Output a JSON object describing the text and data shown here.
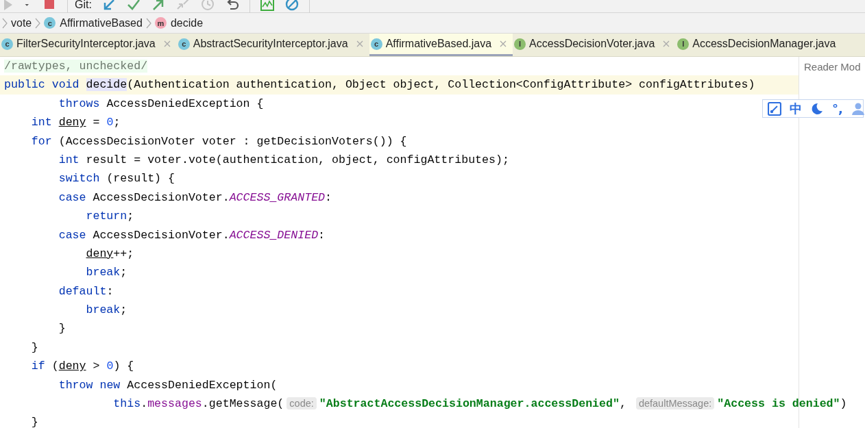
{
  "toolbar": {
    "items": [
      {
        "kind": "run",
        "disabled": true
      },
      {
        "kind": "dropdown",
        "disabled": false
      },
      {
        "kind": "stop",
        "disabled": false
      },
      {
        "kind": "separator"
      },
      {
        "kind": "label",
        "text": "Git:"
      },
      {
        "kind": "update",
        "disabled": false
      },
      {
        "kind": "commit",
        "disabled": false
      },
      {
        "kind": "push",
        "disabled": false
      },
      {
        "kind": "merge",
        "disabled": true
      },
      {
        "kind": "history",
        "disabled": true
      },
      {
        "kind": "rollback",
        "disabled": false
      },
      {
        "kind": "separator"
      },
      {
        "kind": "chart",
        "disabled": false
      },
      {
        "kind": "block",
        "disabled": false
      },
      {
        "kind": "separator"
      }
    ]
  },
  "breadcrumbs": [
    {
      "label": "vote"
    },
    {
      "kind": "class",
      "letter": "c",
      "label": "AffirmativeBased"
    },
    {
      "kind": "method",
      "letter": "m",
      "label": "decide"
    }
  ],
  "tabs": [
    {
      "kind": "class",
      "letter": "c",
      "label": "FilterSecurityInterceptor.java",
      "selected": false,
      "closable": true
    },
    {
      "kind": "class",
      "letter": "c",
      "label": "AbstractSecurityInterceptor.java",
      "selected": false,
      "closable": true
    },
    {
      "kind": "class",
      "letter": "c",
      "label": "AffirmativeBased.java",
      "selected": true,
      "closable": true
    },
    {
      "kind": "interface",
      "letter": "I",
      "label": "AccessDecisionVoter.java",
      "selected": false,
      "closable": true
    },
    {
      "kind": "interface",
      "letter": "I",
      "label": "AccessDecisionManager.java",
      "selected": false,
      "closable": false
    }
  ],
  "reader_mode": "Reader Mod",
  "ime_toolbar": {
    "items": [
      {
        "kind": "gauge"
      },
      {
        "kind": "text",
        "text": "中"
      },
      {
        "kind": "moon"
      },
      {
        "kind": "text",
        "text": "°,"
      },
      {
        "kind": "person"
      }
    ]
  },
  "code": {
    "lines": [
      {
        "current": false,
        "tokens": [
          {
            "kind": "annotation",
            "text": "/rawtypes, unchecked/"
          }
        ]
      },
      {
        "current": true,
        "tokens": [
          {
            "kind": "keyword",
            "text": "public void "
          },
          {
            "kind": "highlight",
            "text": "decide"
          },
          {
            "kind": "plain",
            "text": "(Authentication authentication, Object object, Collection<ConfigAttribute> configAttributes)"
          }
        ]
      },
      {
        "current": false,
        "tokens": [
          {
            "kind": "keyword",
            "text": "        throws"
          },
          {
            "kind": "plain",
            "text": " AccessDeniedException {"
          }
        ]
      },
      {
        "current": false,
        "tokens": [
          {
            "kind": "keyword",
            "text": "    int "
          },
          {
            "kind": "local",
            "text": "deny"
          },
          {
            "kind": "plain",
            "text": " = "
          },
          {
            "kind": "number",
            "text": "0"
          },
          {
            "kind": "plain",
            "text": ";"
          }
        ]
      },
      {
        "current": false,
        "tokens": [
          {
            "kind": "keyword",
            "text": "    for"
          },
          {
            "kind": "plain",
            "text": " (AccessDecisionVoter voter : getDecisionVoters()) {"
          }
        ]
      },
      {
        "current": false,
        "tokens": [
          {
            "kind": "keyword",
            "text": "        int"
          },
          {
            "kind": "plain",
            "text": " result = voter.vote(authentication, object, configAttributes);"
          }
        ]
      },
      {
        "current": false,
        "tokens": [
          {
            "kind": "keyword",
            "text": "        switch"
          },
          {
            "kind": "plain",
            "text": " (result) {"
          }
        ]
      },
      {
        "current": false,
        "tokens": [
          {
            "kind": "keyword",
            "text": "        case"
          },
          {
            "kind": "plain",
            "text": " AccessDecisionVoter."
          },
          {
            "kind": "constant",
            "text": "ACCESS_GRANTED"
          },
          {
            "kind": "plain",
            "text": ":"
          }
        ]
      },
      {
        "current": false,
        "tokens": [
          {
            "kind": "keyword",
            "text": "            return"
          },
          {
            "kind": "plain",
            "text": ";"
          }
        ]
      },
      {
        "current": false,
        "tokens": [
          {
            "kind": "keyword",
            "text": "        case"
          },
          {
            "kind": "plain",
            "text": " AccessDecisionVoter."
          },
          {
            "kind": "constant",
            "text": "ACCESS_DENIED"
          },
          {
            "kind": "plain",
            "text": ":"
          }
        ]
      },
      {
        "current": false,
        "tokens": [
          {
            "kind": "local",
            "text": "            deny"
          },
          {
            "kind": "plain",
            "text": "++;"
          }
        ]
      },
      {
        "current": false,
        "tokens": [
          {
            "kind": "keyword",
            "text": "            break"
          },
          {
            "kind": "plain",
            "text": ";"
          }
        ]
      },
      {
        "current": false,
        "tokens": [
          {
            "kind": "keyword",
            "text": "        default"
          },
          {
            "kind": "plain",
            "text": ":"
          }
        ]
      },
      {
        "current": false,
        "tokens": [
          {
            "kind": "keyword",
            "text": "            break"
          },
          {
            "kind": "plain",
            "text": ";"
          }
        ]
      },
      {
        "current": false,
        "tokens": [
          {
            "kind": "plain",
            "text": "        }"
          }
        ]
      },
      {
        "current": false,
        "tokens": [
          {
            "kind": "plain",
            "text": "    }"
          }
        ]
      },
      {
        "current": false,
        "tokens": [
          {
            "kind": "keyword",
            "text": "    if"
          },
          {
            "kind": "plain",
            "text": " ("
          },
          {
            "kind": "local",
            "text": "deny"
          },
          {
            "kind": "plain",
            "text": " > "
          },
          {
            "kind": "number",
            "text": "0"
          },
          {
            "kind": "plain",
            "text": ") {"
          }
        ]
      },
      {
        "current": false,
        "tokens": [
          {
            "kind": "keyword",
            "text": "        throw new"
          },
          {
            "kind": "plain",
            "text": " AccessDeniedException("
          }
        ]
      },
      {
        "current": false,
        "tokens": [
          {
            "kind": "keyword",
            "text": "                this"
          },
          {
            "kind": "plain",
            "text": "."
          },
          {
            "kind": "field",
            "text": "messages"
          },
          {
            "kind": "plain",
            "text": ".getMessage("
          },
          {
            "kind": "hint",
            "text": "code:"
          },
          {
            "kind": "string",
            "text": "\"AbstractAccessDecisionManager.accessDenied\""
          },
          {
            "kind": "plain",
            "text": ", "
          },
          {
            "kind": "hint",
            "text": "defaultMessage:"
          },
          {
            "kind": "string",
            "text": "\"Access is denied\""
          },
          {
            "kind": "plain",
            "text": ")"
          }
        ]
      },
      {
        "current": false,
        "tokens": [
          {
            "kind": "plain",
            "text": "    }"
          }
        ]
      }
    ]
  }
}
